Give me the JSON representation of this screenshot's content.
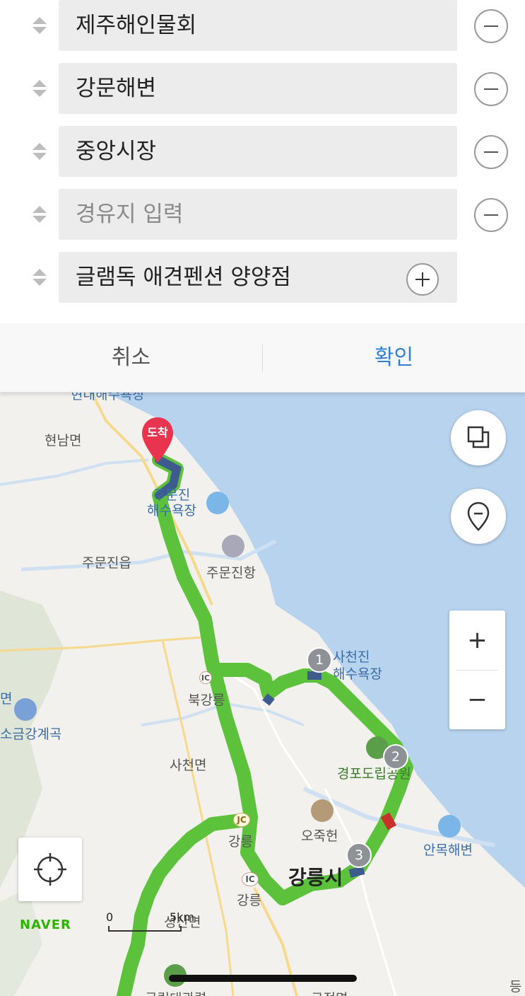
{
  "waypoints": [
    {
      "text": "제주해인물회",
      "placeholder": false,
      "action": "remove"
    },
    {
      "text": "강문해변",
      "placeholder": false,
      "action": "remove"
    },
    {
      "text": "중앙시장",
      "placeholder": false,
      "action": "remove"
    },
    {
      "text": "경유지 입력",
      "placeholder": true,
      "action": "remove"
    },
    {
      "text": "글램독 애견펜션 양양점",
      "placeholder": false,
      "action": "add"
    }
  ],
  "actions": {
    "cancel": "취소",
    "confirm": "확인"
  },
  "map": {
    "destination_pin": "도착",
    "stops": [
      "1",
      "2",
      "3"
    ],
    "labels": {
      "top_clipped": "현대해수욕장",
      "hyeonnam": "현남면",
      "jumunjin_beach": "주문진\n해수욕장",
      "jumunjin_eup": "주문진읍",
      "jumunjin_port": "주문진항",
      "sacheonjin_beach": "사천진\n해수욕장",
      "buk_gangneung": "북강릉",
      "ic": "IC",
      "jc": "JC",
      "geumgang": "소금강계곡",
      "left_edge": "면",
      "sacheon": "사천면",
      "gyeongpo": "경포도립공원",
      "ojukheon": "오죽헌",
      "gangneung_jc": "강릉",
      "anmok": "안목해변",
      "gangneung_city": "강릉시",
      "gangneung_ic": "강릉",
      "seongsan": "성산면",
      "gujeong": "구정면",
      "daegwallyeong": "국립대관령",
      "right_bottom": "등"
    },
    "scale": {
      "zero": "0",
      "distance": "5km"
    },
    "brand": "NAVER",
    "colors": {
      "route": "#5cc23c",
      "sea": "#b8d3ee",
      "land": "#f2f1ed",
      "congestion": "#c8302a",
      "pin": "#e8344e"
    }
  }
}
